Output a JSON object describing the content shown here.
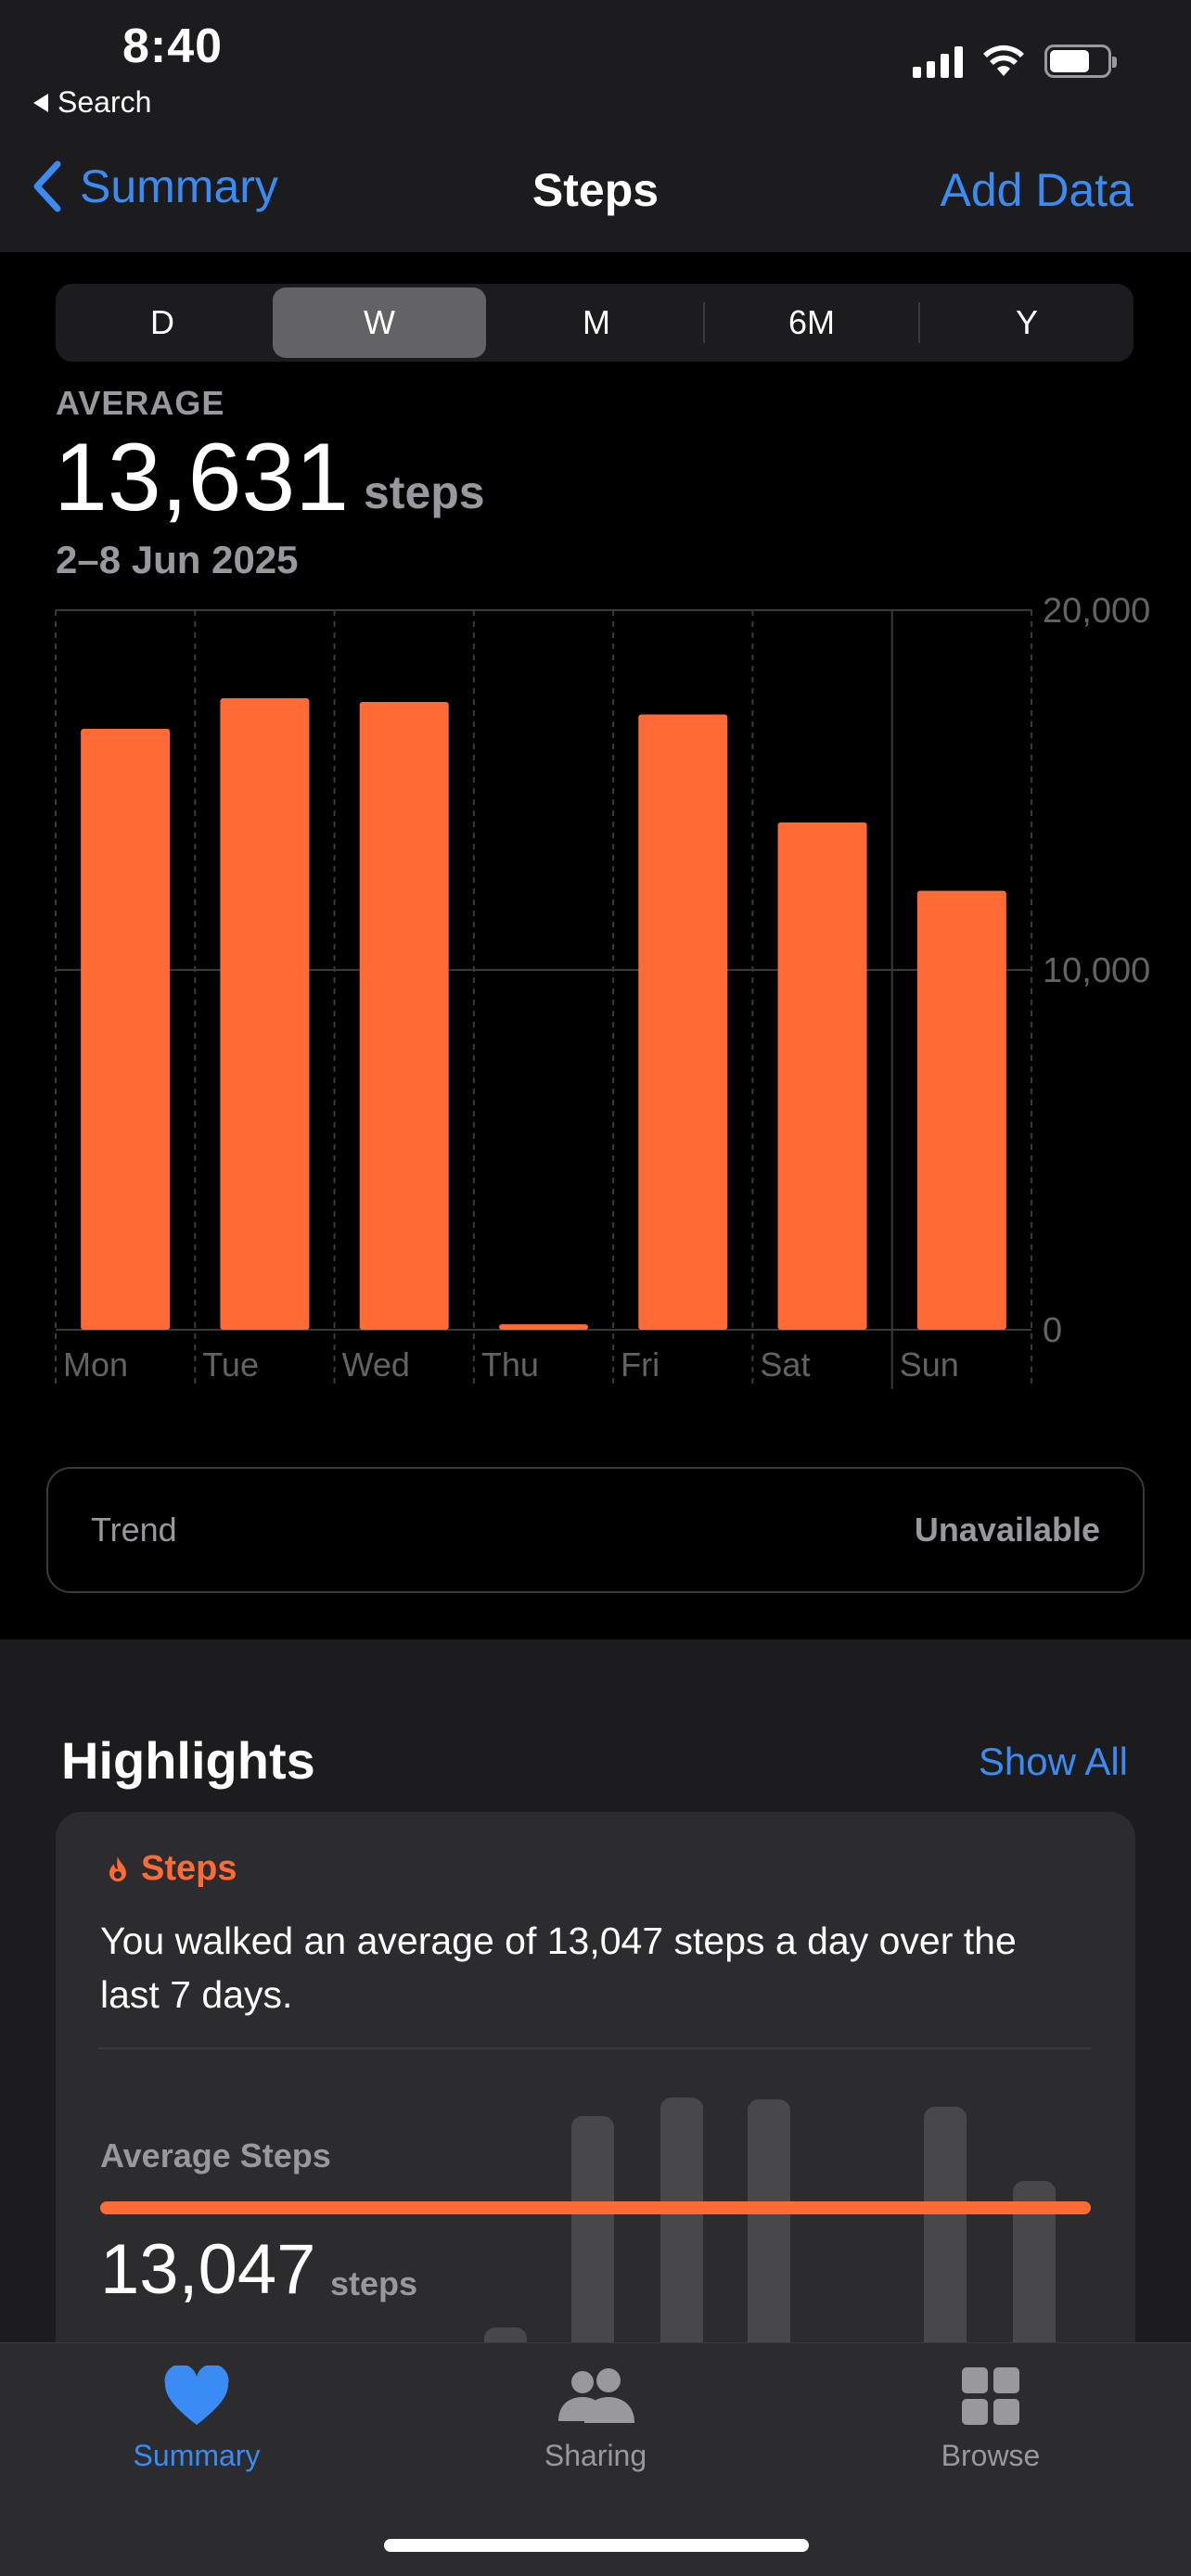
{
  "status_bar": {
    "time": "8:40",
    "back_app": "Search"
  },
  "nav": {
    "back_label": "Summary",
    "title": "Steps",
    "action_label": "Add Data"
  },
  "segments": [
    {
      "label": "D",
      "active": false
    },
    {
      "label": "W",
      "active": true
    },
    {
      "label": "M",
      "active": false
    },
    {
      "label": "6M",
      "active": false
    },
    {
      "label": "Y",
      "active": false
    }
  ],
  "summary": {
    "label": "AVERAGE",
    "value": "13,631",
    "unit": "steps",
    "date_range": "2–8 Jun 2025"
  },
  "chart_data": {
    "type": "bar",
    "categories": [
      "Mon",
      "Tue",
      "Wed",
      "Thu",
      "Fri",
      "Sat",
      "Sun"
    ],
    "values": [
      16700,
      17550,
      17450,
      150,
      17100,
      14100,
      12200
    ],
    "ylim": [
      0,
      20000
    ],
    "y_ticks": [
      "0",
      "10,000",
      "20,000"
    ],
    "y_tick_values": [
      0,
      10000,
      20000
    ],
    "grid": true,
    "bar_color": "#ff6a35"
  },
  "trend": {
    "label": "Trend",
    "value": "Unavailable"
  },
  "highlights": {
    "title": "Highlights",
    "show_all": "Show All",
    "card": {
      "tag": "Steps",
      "text": "You walked an average of 13,047 steps a day over the last 7 days.",
      "metric_label": "Average Steps",
      "metric_value": "13,047",
      "metric_unit": "steps"
    }
  },
  "tabbar": {
    "items": [
      {
        "label": "Summary",
        "icon": "heart-icon",
        "active": true
      },
      {
        "label": "Sharing",
        "icon": "people-icon",
        "active": false
      },
      {
        "label": "Browse",
        "icon": "grid-icon",
        "active": false
      }
    ]
  },
  "colors": {
    "accent": "#3b8bf5",
    "steps": "#ff6a35"
  }
}
